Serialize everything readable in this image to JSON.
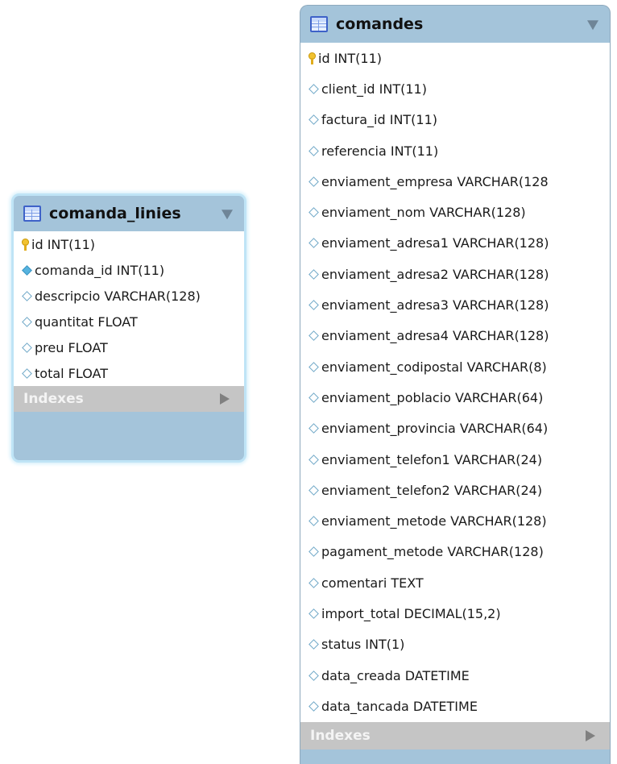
{
  "tables": [
    {
      "name": "comanda_linies",
      "columns": [
        {
          "text": "id INT(11)",
          "icon": "primary-key-icon"
        },
        {
          "text": "comanda_id INT(11)",
          "icon": "foreign-key-diamond-icon"
        },
        {
          "text": "descripcio VARCHAR(128)",
          "icon": "column-diamond-icon"
        },
        {
          "text": "quantitat FLOAT",
          "icon": "column-diamond-icon"
        },
        {
          "text": "preu FLOAT",
          "icon": "column-diamond-icon"
        },
        {
          "text": "total FLOAT",
          "icon": "column-diamond-icon"
        }
      ],
      "indexes_label": "Indexes"
    },
    {
      "name": "comandes",
      "columns": [
        {
          "text": "id INT(11)",
          "icon": "primary-key-icon"
        },
        {
          "text": "client_id INT(11)",
          "icon": "column-diamond-icon"
        },
        {
          "text": "factura_id INT(11)",
          "icon": "column-diamond-icon"
        },
        {
          "text": "referencia INT(11)",
          "icon": "column-diamond-icon"
        },
        {
          "text": "enviament_empresa VARCHAR(128",
          "icon": "column-diamond-icon"
        },
        {
          "text": "enviament_nom VARCHAR(128)",
          "icon": "column-diamond-icon"
        },
        {
          "text": "enviament_adresa1 VARCHAR(128)",
          "icon": "column-diamond-icon"
        },
        {
          "text": "enviament_adresa2 VARCHAR(128)",
          "icon": "column-diamond-icon"
        },
        {
          "text": "enviament_adresa3 VARCHAR(128)",
          "icon": "column-diamond-icon"
        },
        {
          "text": "enviament_adresa4 VARCHAR(128)",
          "icon": "column-diamond-icon"
        },
        {
          "text": "enviament_codipostal VARCHAR(8)",
          "icon": "column-diamond-icon"
        },
        {
          "text": "enviament_poblacio VARCHAR(64)",
          "icon": "column-diamond-icon"
        },
        {
          "text": "enviament_provincia VARCHAR(64)",
          "icon": "column-diamond-icon"
        },
        {
          "text": "enviament_telefon1 VARCHAR(24)",
          "icon": "column-diamond-icon"
        },
        {
          "text": "enviament_telefon2 VARCHAR(24)",
          "icon": "column-diamond-icon"
        },
        {
          "text": "enviament_metode VARCHAR(128)",
          "icon": "column-diamond-icon"
        },
        {
          "text": "pagament_metode VARCHAR(128)",
          "icon": "column-diamond-icon"
        },
        {
          "text": "comentari TEXT",
          "icon": "column-diamond-icon"
        },
        {
          "text": "import_total DECIMAL(15,2)",
          "icon": "column-diamond-icon"
        },
        {
          "text": "status INT(1)",
          "icon": "column-diamond-icon"
        },
        {
          "text": "data_creada DATETIME",
          "icon": "column-diamond-icon"
        },
        {
          "text": "data_tancada DATETIME",
          "icon": "column-diamond-icon"
        }
      ],
      "indexes_label": "Indexes"
    }
  ],
  "colors": {
    "header_bg": "#a4c4da",
    "indexes_bg": "#c5c5c5",
    "selected_glow": "#bfe4f6",
    "key_icon": "#f1c230",
    "fk_diamond": "#56b3df"
  }
}
